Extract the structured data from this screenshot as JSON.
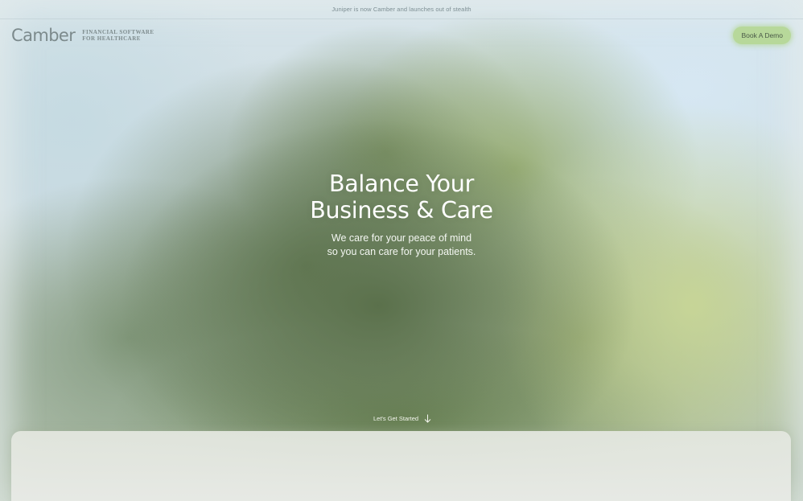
{
  "announcement": {
    "text": "Juniper is now Camber and launches out of stealth"
  },
  "header": {
    "logo_text": "Camber",
    "tagline_line1": "FINANCIAL SOFTWARE",
    "tagline_line2": "FOR HEALTHCARE",
    "demo_button_label": "Book A Demo"
  },
  "hero": {
    "title_line1": "Balance Your",
    "title_line2": "Business & Care",
    "subtitle_line1": "We care for your peace of mind",
    "subtitle_line2": "so you can care for your patients.",
    "cta_label": "Let's Get Started",
    "cta_icon": "arrow-down-icon"
  },
  "colors": {
    "accent_button": "#b7d89a",
    "hero_text": "#ffffff"
  }
}
